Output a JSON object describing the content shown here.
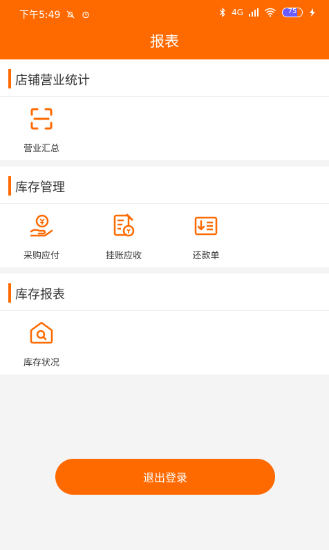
{
  "status": {
    "time": "下午5:49",
    "signal": "4G",
    "battery_percent": 75,
    "battery_label": "75"
  },
  "header": {
    "title": "报表"
  },
  "sections": [
    {
      "title": "店铺营业统计",
      "items": [
        {
          "label": "营业汇总",
          "icon": "scan-frame-icon"
        }
      ]
    },
    {
      "title": "库存管理",
      "items": [
        {
          "label": "采购应付",
          "icon": "hand-coin-icon"
        },
        {
          "label": "挂账应收",
          "icon": "ledger-coin-icon"
        },
        {
          "label": "还款单",
          "icon": "repayment-slip-icon"
        }
      ]
    },
    {
      "title": "库存报表",
      "items": [
        {
          "label": "库存状况",
          "icon": "warehouse-search-icon"
        }
      ]
    }
  ],
  "logout": {
    "label": "退出登录"
  },
  "colors": {
    "accent": "#ff6a00",
    "background": "#f4f4f4"
  }
}
